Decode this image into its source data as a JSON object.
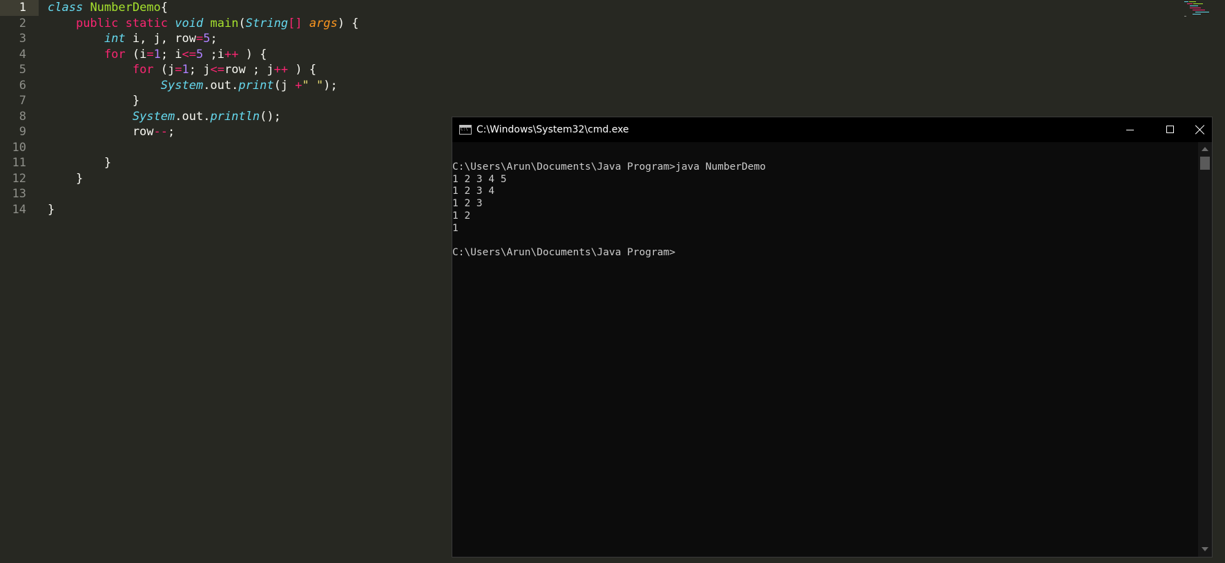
{
  "editor": {
    "line_numbers": [
      "1",
      "2",
      "3",
      "4",
      "5",
      "6",
      "7",
      "8",
      "9",
      "10",
      "11",
      "12",
      "13",
      "14"
    ],
    "lines": [
      [
        {
          "t": "class",
          "c": "tok-st"
        },
        {
          "t": " ",
          "c": "tok-plain"
        },
        {
          "t": "NumberDemo",
          "c": "tok-cls"
        },
        {
          "t": "{",
          "c": "tok-plain"
        }
      ],
      [
        {
          "t": "    ",
          "c": "tok-plain"
        },
        {
          "t": "public",
          "c": "tok-kw"
        },
        {
          "t": " ",
          "c": "tok-plain"
        },
        {
          "t": "static",
          "c": "tok-kw"
        },
        {
          "t": " ",
          "c": "tok-plain"
        },
        {
          "t": "void",
          "c": "tok-st"
        },
        {
          "t": " ",
          "c": "tok-plain"
        },
        {
          "t": "main",
          "c": "tok-fn"
        },
        {
          "t": "(",
          "c": "tok-plain"
        },
        {
          "t": "String",
          "c": "tok-type"
        },
        {
          "t": "[]",
          "c": "tok-op"
        },
        {
          "t": " ",
          "c": "tok-plain"
        },
        {
          "t": "args",
          "c": "tok-param"
        },
        {
          "t": ") {",
          "c": "tok-plain"
        }
      ],
      [
        {
          "t": "        ",
          "c": "tok-plain"
        },
        {
          "t": "int",
          "c": "tok-st"
        },
        {
          "t": " i, j, row",
          "c": "tok-plain"
        },
        {
          "t": "=",
          "c": "tok-op"
        },
        {
          "t": "5",
          "c": "tok-num"
        },
        {
          "t": ";",
          "c": "tok-plain"
        }
      ],
      [
        {
          "t": "        ",
          "c": "tok-plain"
        },
        {
          "t": "for",
          "c": "tok-kw"
        },
        {
          "t": " (i",
          "c": "tok-plain"
        },
        {
          "t": "=",
          "c": "tok-op"
        },
        {
          "t": "1",
          "c": "tok-num"
        },
        {
          "t": "; i",
          "c": "tok-plain"
        },
        {
          "t": "<=",
          "c": "tok-op"
        },
        {
          "t": "5",
          "c": "tok-num"
        },
        {
          "t": " ;i",
          "c": "tok-plain"
        },
        {
          "t": "++",
          "c": "tok-op"
        },
        {
          "t": " ) {",
          "c": "tok-plain"
        }
      ],
      [
        {
          "t": "            ",
          "c": "tok-plain"
        },
        {
          "t": "for",
          "c": "tok-kw"
        },
        {
          "t": " (j",
          "c": "tok-plain"
        },
        {
          "t": "=",
          "c": "tok-op"
        },
        {
          "t": "1",
          "c": "tok-num"
        },
        {
          "t": "; j",
          "c": "tok-plain"
        },
        {
          "t": "<=",
          "c": "tok-op"
        },
        {
          "t": "row ; j",
          "c": "tok-plain"
        },
        {
          "t": "++",
          "c": "tok-op"
        },
        {
          "t": " ) {",
          "c": "tok-plain"
        }
      ],
      [
        {
          "t": "                ",
          "c": "tok-plain"
        },
        {
          "t": "System",
          "c": "tok-sys"
        },
        {
          "t": ".out.",
          "c": "tok-plain"
        },
        {
          "t": "print",
          "c": "tok-st"
        },
        {
          "t": "(j ",
          "c": "tok-plain"
        },
        {
          "t": "+",
          "c": "tok-op"
        },
        {
          "t": "\" \"",
          "c": "tok-str"
        },
        {
          "t": ");",
          "c": "tok-plain"
        }
      ],
      [
        {
          "t": "            }",
          "c": "tok-plain"
        }
      ],
      [
        {
          "t": "            ",
          "c": "tok-plain"
        },
        {
          "t": "System",
          "c": "tok-sys"
        },
        {
          "t": ".out.",
          "c": "tok-plain"
        },
        {
          "t": "println",
          "c": "tok-st"
        },
        {
          "t": "();",
          "c": "tok-plain"
        }
      ],
      [
        {
          "t": "            row",
          "c": "tok-plain"
        },
        {
          "t": "--",
          "c": "tok-op"
        },
        {
          "t": ";",
          "c": "tok-plain"
        }
      ],
      [],
      [
        {
          "t": "        }",
          "c": "tok-plain"
        }
      ],
      [
        {
          "t": "    }",
          "c": "tok-plain"
        }
      ],
      [],
      [
        {
          "t": "}",
          "c": "tok-plain"
        }
      ]
    ]
  },
  "cmd": {
    "title": "C:\\Windows\\System32\\cmd.exe",
    "console_lines": [
      "",
      "C:\\Users\\Arun\\Documents\\Java Program>java NumberDemo",
      "1 2 3 4 5",
      "1 2 3 4",
      "1 2 3",
      "1 2",
      "1",
      "",
      "C:\\Users\\Arun\\Documents\\Java Program>"
    ]
  },
  "colors": {
    "editor_bg": "#272822",
    "console_bg": "#0c0c0c",
    "console_fg": "#cccccc",
    "titlebar_bg": "#000000"
  }
}
